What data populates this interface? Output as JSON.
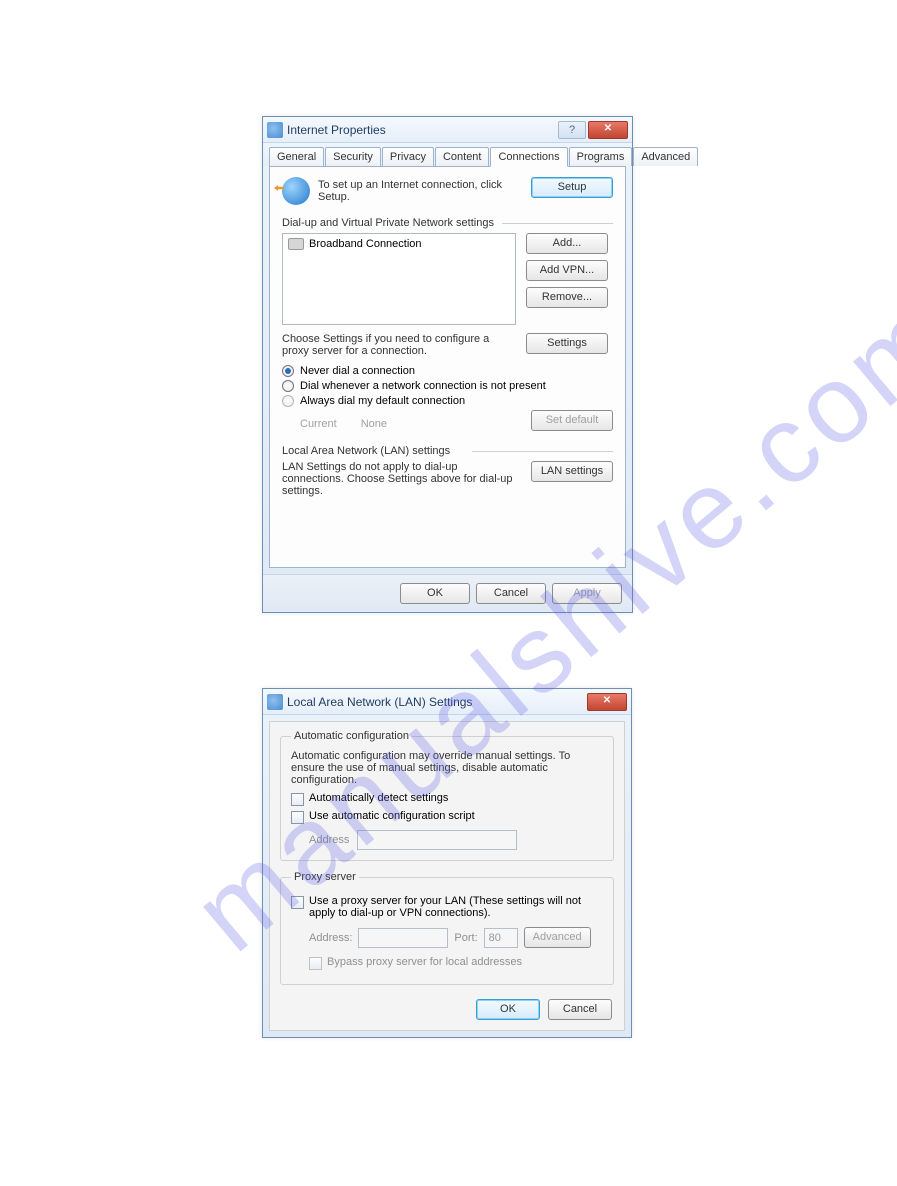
{
  "watermark": "manualshive.com",
  "dialog1": {
    "title": "Internet Properties",
    "tabs": [
      "General",
      "Security",
      "Privacy",
      "Content",
      "Connections",
      "Programs",
      "Advanced"
    ],
    "active_tab": 4,
    "setup_text": "To set up an Internet connection, click Setup.",
    "setup_btn": "Setup",
    "section1_label": "Dial-up and Virtual Private Network settings",
    "connection_item": "Broadband Connection",
    "add_btn": "Add...",
    "addvpn_btn": "Add VPN...",
    "remove_btn": "Remove...",
    "choose_text": "Choose Settings if you need to configure a proxy server for a connection.",
    "settings_btn": "Settings",
    "radio_never": "Never dial a connection",
    "radio_whenever": "Dial whenever a network connection is not present",
    "radio_always": "Always dial my default connection",
    "current_label": "Current",
    "current_value": "None",
    "setdefault_btn": "Set default",
    "section2_label": "Local Area Network (LAN) settings",
    "lan_text": "LAN Settings do not apply to dial-up connections. Choose Settings above for dial-up settings.",
    "lan_btn": "LAN settings",
    "ok": "OK",
    "cancel": "Cancel",
    "apply": "Apply"
  },
  "dialog2": {
    "title": "Local Area Network (LAN) Settings",
    "group1_legend": "Automatic configuration",
    "group1_desc": "Automatic configuration may override manual settings.  To ensure the use of manual settings, disable automatic configuration.",
    "chk_auto_detect": "Automatically detect settings",
    "chk_auto_script": "Use automatic configuration script",
    "address_label": "Address",
    "group2_legend": "Proxy server",
    "chk_useproxy": "Use a proxy server for your LAN (These settings will not apply to dial-up or VPN connections).",
    "address_label2": "Address:",
    "port_label": "Port:",
    "port_value": "80",
    "advanced_btn": "Advanced",
    "chk_bypass": "Bypass proxy server for local addresses",
    "ok": "OK",
    "cancel": "Cancel"
  }
}
